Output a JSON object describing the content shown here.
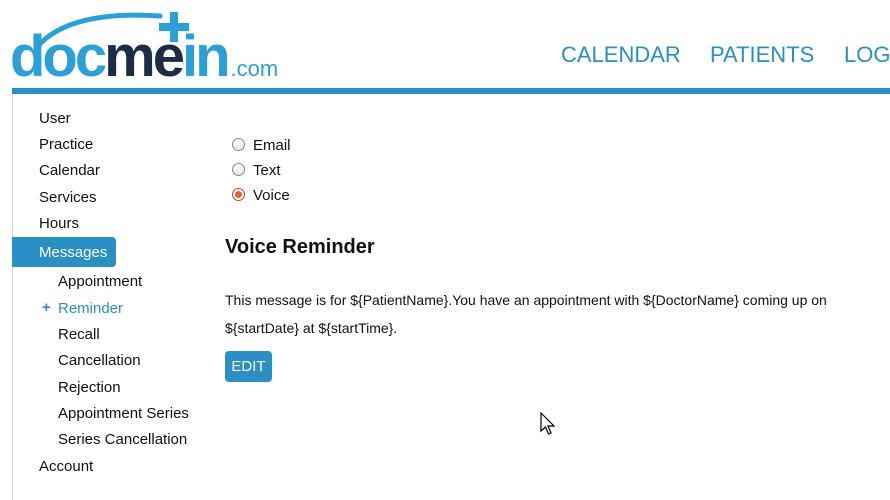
{
  "header": {
    "logo": {
      "part1": "doc",
      "part2": "me",
      "part3": "in",
      "suffix": ".com"
    },
    "nav": [
      {
        "label": "CALENDAR"
      },
      {
        "label": "PATIENTS"
      },
      {
        "label": "LOG"
      }
    ],
    "accent_color": "#2a8fc4"
  },
  "sidebar": {
    "items": [
      {
        "label": "User"
      },
      {
        "label": "Practice"
      },
      {
        "label": "Calendar"
      },
      {
        "label": "Services"
      },
      {
        "label": "Hours"
      },
      {
        "label": "Messages",
        "active": true
      },
      {
        "label": "Appointment"
      },
      {
        "label": "Reminder",
        "current": true,
        "marker": "+"
      },
      {
        "label": "Recall"
      },
      {
        "label": "Cancellation"
      },
      {
        "label": "Rejection"
      },
      {
        "label": "Appointment Series"
      },
      {
        "label": "Series Cancellation"
      },
      {
        "label": "Account"
      }
    ]
  },
  "main": {
    "radio_options": [
      {
        "label": "Email",
        "selected": false
      },
      {
        "label": "Text",
        "selected": false
      },
      {
        "label": "Voice",
        "selected": true
      }
    ],
    "section_title": "Voice Reminder",
    "message": "This message is for ${PatientName}.You have an appointment with ${DoctorName} coming up on ${startDate} at ${startTime}.",
    "edit_label": "EDIT"
  }
}
